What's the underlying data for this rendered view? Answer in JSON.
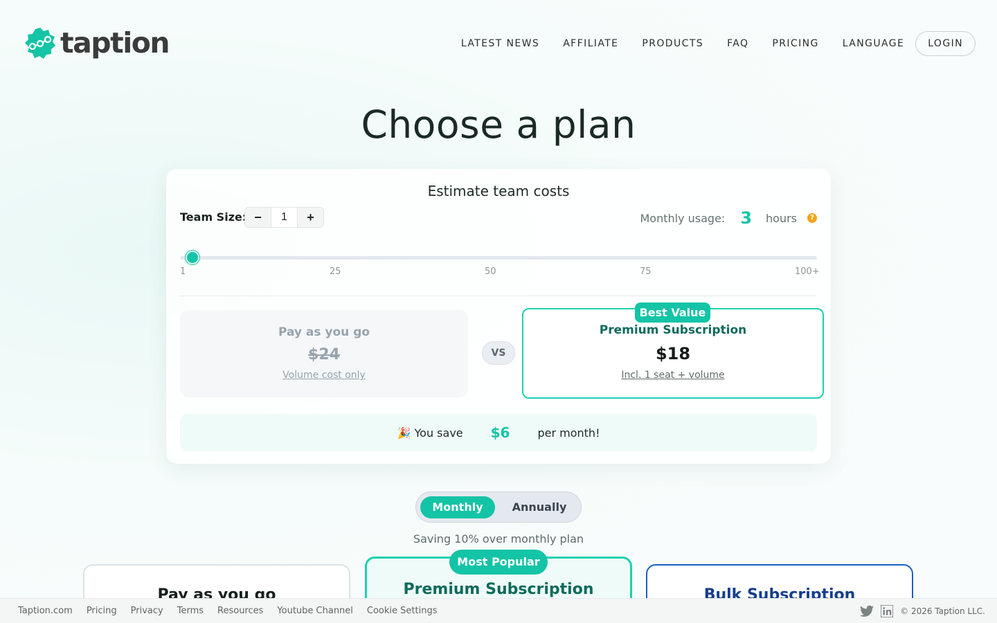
{
  "brand": {
    "name": "taption",
    "accent": "#14c4a6"
  },
  "nav": {
    "items": [
      "LATEST NEWS",
      "AFFILIATE",
      "PRODUCTS",
      "FAQ",
      "PRICING",
      "LANGUAGE"
    ],
    "login": "LOGIN"
  },
  "page": {
    "title": "Choose a plan"
  },
  "estimator": {
    "title": "Estimate team costs",
    "team_label": "Team Size:",
    "team_value": "1",
    "minus": "−",
    "plus": "+",
    "usage_label": "Monthly usage:",
    "usage_value": "3",
    "usage_unit": "hours",
    "help": "?",
    "slider": {
      "value": 1,
      "min": 1,
      "max": 100
    },
    "ticks": [
      "1",
      "25",
      "50",
      "75",
      "100+"
    ],
    "payg": {
      "title": "Pay as you go",
      "price": "$24",
      "note": "Volume cost only"
    },
    "vs": "VS",
    "premium": {
      "badge": "Best Value",
      "title": "Premium Subscription",
      "price": "$18",
      "note": "Incl. 1 seat + volume"
    },
    "savings": {
      "prefix": "🎉 You save",
      "amount": "$6",
      "suffix": "per month!"
    }
  },
  "billing": {
    "monthly": "Monthly",
    "annually": "Annually",
    "note": "Saving 10% over monthly plan"
  },
  "plans": {
    "payg": "Pay as you go",
    "premium": "Premium Subscription",
    "popular_badge": "Most Popular",
    "bulk": "Bulk Subscription"
  },
  "footer": {
    "links": [
      "Taption.com",
      "Pricing",
      "Privacy",
      "Terms",
      "Resources",
      "Youtube Channel",
      "Cookie Settings"
    ],
    "icons": [
      "twitter-icon",
      "linkedin-icon"
    ],
    "copyright": "© 2026 Taption LLC."
  }
}
